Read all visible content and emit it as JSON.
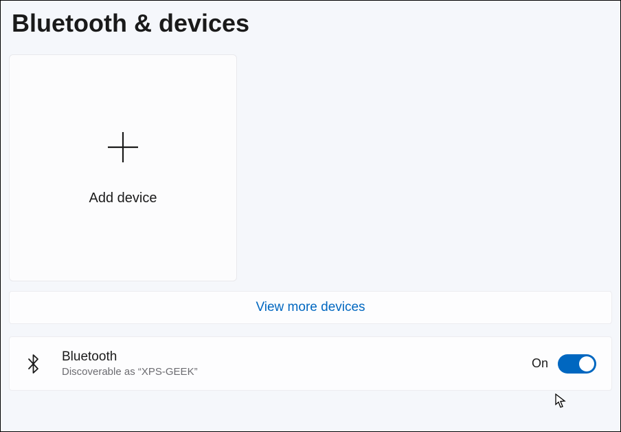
{
  "page": {
    "title": "Bluetooth & devices"
  },
  "addDevice": {
    "label": "Add device"
  },
  "viewMore": {
    "label": "View more devices"
  },
  "bluetooth": {
    "title": "Bluetooth",
    "subtitle": "Discoverable as “XPS-GEEK”",
    "toggleState": "On",
    "toggleOn": true
  },
  "colors": {
    "accent": "#0067c0",
    "link": "#0067c0",
    "bg": "#f5f7fb",
    "card": "#fdfdfe"
  }
}
